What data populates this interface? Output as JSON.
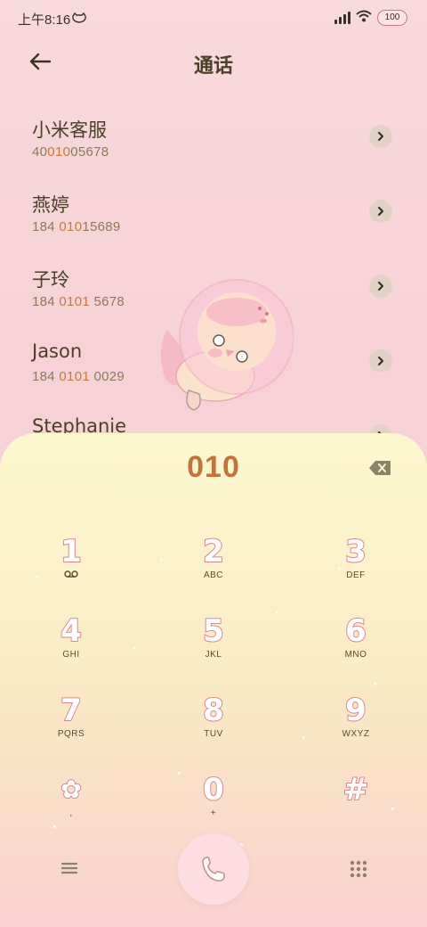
{
  "status_bar": {
    "time": "上午8:16",
    "battery": "100",
    "icons": [
      "cat-face-icon",
      "signal-icon",
      "wifi-icon",
      "battery-icon"
    ]
  },
  "header": {
    "title": "通话",
    "back_icon": "arrow-left-icon"
  },
  "contacts": [
    {
      "name": "小米客服",
      "number_pre": "40",
      "number_hl": "010",
      "number_post": "05678"
    },
    {
      "name": "燕婷",
      "number_pre": "184 ",
      "number_hl": "010",
      "number_post": "15689"
    },
    {
      "name": "子玲",
      "number_pre": "184 ",
      "number_hl": "0101",
      "number_post": " 5678"
    },
    {
      "name": "Jason",
      "number_pre": "184 ",
      "number_hl": "0101",
      "number_post": " 0029"
    },
    {
      "name": "Stephanie",
      "number_pre": "",
      "number_hl": "",
      "number_post": ""
    }
  ],
  "dialer": {
    "entered_number": "010",
    "keys": [
      {
        "digit": "1",
        "sub": "voicemail-icon"
      },
      {
        "digit": "2",
        "sub": "ABC"
      },
      {
        "digit": "3",
        "sub": "DEF"
      },
      {
        "digit": "4",
        "sub": "GHI"
      },
      {
        "digit": "5",
        "sub": "JKL"
      },
      {
        "digit": "6",
        "sub": "MNO"
      },
      {
        "digit": "7",
        "sub": "PQRS"
      },
      {
        "digit": "8",
        "sub": "TUV"
      },
      {
        "digit": "9",
        "sub": "WXYZ"
      },
      {
        "digit": "✿",
        "sub": ","
      },
      {
        "digit": "0",
        "sub": "+"
      },
      {
        "digit": "#",
        "sub": ""
      }
    ]
  },
  "colors": {
    "highlight": "#c47a3a",
    "key_outline": "#d48a93",
    "title": "#4a4028"
  }
}
